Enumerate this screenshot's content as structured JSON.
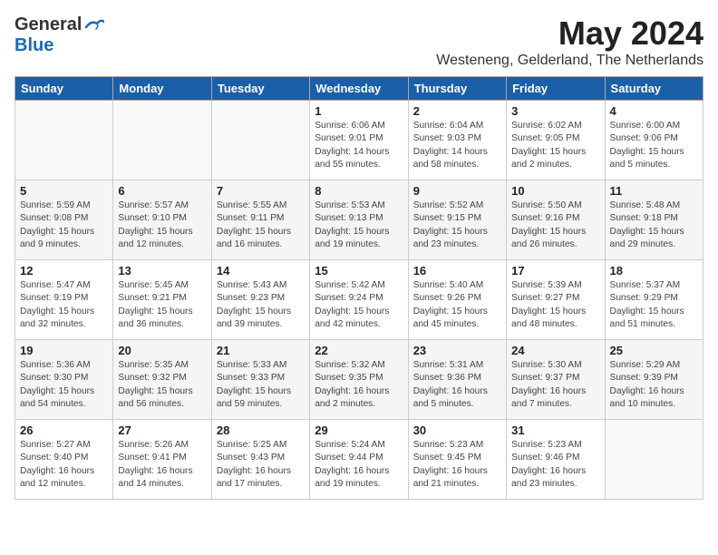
{
  "header": {
    "logo_general": "General",
    "logo_blue": "Blue",
    "month": "May 2024",
    "location": "Westeneng, Gelderland, The Netherlands"
  },
  "days_of_week": [
    "Sunday",
    "Monday",
    "Tuesday",
    "Wednesday",
    "Thursday",
    "Friday",
    "Saturday"
  ],
  "weeks": [
    [
      {
        "day": "",
        "info": ""
      },
      {
        "day": "",
        "info": ""
      },
      {
        "day": "",
        "info": ""
      },
      {
        "day": "1",
        "info": "Sunrise: 6:06 AM\nSunset: 9:01 PM\nDaylight: 14 hours\nand 55 minutes."
      },
      {
        "day": "2",
        "info": "Sunrise: 6:04 AM\nSunset: 9:03 PM\nDaylight: 14 hours\nand 58 minutes."
      },
      {
        "day": "3",
        "info": "Sunrise: 6:02 AM\nSunset: 9:05 PM\nDaylight: 15 hours\nand 2 minutes."
      },
      {
        "day": "4",
        "info": "Sunrise: 6:00 AM\nSunset: 9:06 PM\nDaylight: 15 hours\nand 5 minutes."
      }
    ],
    [
      {
        "day": "5",
        "info": "Sunrise: 5:59 AM\nSunset: 9:08 PM\nDaylight: 15 hours\nand 9 minutes."
      },
      {
        "day": "6",
        "info": "Sunrise: 5:57 AM\nSunset: 9:10 PM\nDaylight: 15 hours\nand 12 minutes."
      },
      {
        "day": "7",
        "info": "Sunrise: 5:55 AM\nSunset: 9:11 PM\nDaylight: 15 hours\nand 16 minutes."
      },
      {
        "day": "8",
        "info": "Sunrise: 5:53 AM\nSunset: 9:13 PM\nDaylight: 15 hours\nand 19 minutes."
      },
      {
        "day": "9",
        "info": "Sunrise: 5:52 AM\nSunset: 9:15 PM\nDaylight: 15 hours\nand 23 minutes."
      },
      {
        "day": "10",
        "info": "Sunrise: 5:50 AM\nSunset: 9:16 PM\nDaylight: 15 hours\nand 26 minutes."
      },
      {
        "day": "11",
        "info": "Sunrise: 5:48 AM\nSunset: 9:18 PM\nDaylight: 15 hours\nand 29 minutes."
      }
    ],
    [
      {
        "day": "12",
        "info": "Sunrise: 5:47 AM\nSunset: 9:19 PM\nDaylight: 15 hours\nand 32 minutes."
      },
      {
        "day": "13",
        "info": "Sunrise: 5:45 AM\nSunset: 9:21 PM\nDaylight: 15 hours\nand 36 minutes."
      },
      {
        "day": "14",
        "info": "Sunrise: 5:43 AM\nSunset: 9:23 PM\nDaylight: 15 hours\nand 39 minutes."
      },
      {
        "day": "15",
        "info": "Sunrise: 5:42 AM\nSunset: 9:24 PM\nDaylight: 15 hours\nand 42 minutes."
      },
      {
        "day": "16",
        "info": "Sunrise: 5:40 AM\nSunset: 9:26 PM\nDaylight: 15 hours\nand 45 minutes."
      },
      {
        "day": "17",
        "info": "Sunrise: 5:39 AM\nSunset: 9:27 PM\nDaylight: 15 hours\nand 48 minutes."
      },
      {
        "day": "18",
        "info": "Sunrise: 5:37 AM\nSunset: 9:29 PM\nDaylight: 15 hours\nand 51 minutes."
      }
    ],
    [
      {
        "day": "19",
        "info": "Sunrise: 5:36 AM\nSunset: 9:30 PM\nDaylight: 15 hours\nand 54 minutes."
      },
      {
        "day": "20",
        "info": "Sunrise: 5:35 AM\nSunset: 9:32 PM\nDaylight: 15 hours\nand 56 minutes."
      },
      {
        "day": "21",
        "info": "Sunrise: 5:33 AM\nSunset: 9:33 PM\nDaylight: 15 hours\nand 59 minutes."
      },
      {
        "day": "22",
        "info": "Sunrise: 5:32 AM\nSunset: 9:35 PM\nDaylight: 16 hours\nand 2 minutes."
      },
      {
        "day": "23",
        "info": "Sunrise: 5:31 AM\nSunset: 9:36 PM\nDaylight: 16 hours\nand 5 minutes."
      },
      {
        "day": "24",
        "info": "Sunrise: 5:30 AM\nSunset: 9:37 PM\nDaylight: 16 hours\nand 7 minutes."
      },
      {
        "day": "25",
        "info": "Sunrise: 5:29 AM\nSunset: 9:39 PM\nDaylight: 16 hours\nand 10 minutes."
      }
    ],
    [
      {
        "day": "26",
        "info": "Sunrise: 5:27 AM\nSunset: 9:40 PM\nDaylight: 16 hours\nand 12 minutes."
      },
      {
        "day": "27",
        "info": "Sunrise: 5:26 AM\nSunset: 9:41 PM\nDaylight: 16 hours\nand 14 minutes."
      },
      {
        "day": "28",
        "info": "Sunrise: 5:25 AM\nSunset: 9:43 PM\nDaylight: 16 hours\nand 17 minutes."
      },
      {
        "day": "29",
        "info": "Sunrise: 5:24 AM\nSunset: 9:44 PM\nDaylight: 16 hours\nand 19 minutes."
      },
      {
        "day": "30",
        "info": "Sunrise: 5:23 AM\nSunset: 9:45 PM\nDaylight: 16 hours\nand 21 minutes."
      },
      {
        "day": "31",
        "info": "Sunrise: 5:23 AM\nSunset: 9:46 PM\nDaylight: 16 hours\nand 23 minutes."
      },
      {
        "day": "",
        "info": ""
      }
    ]
  ]
}
